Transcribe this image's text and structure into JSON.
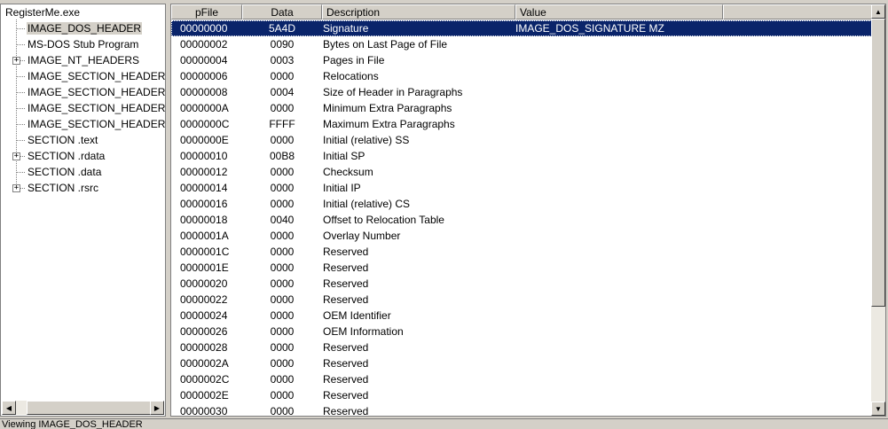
{
  "tree": {
    "root": "RegisterMe.exe",
    "items": [
      {
        "label": "IMAGE_DOS_HEADER",
        "expandable": false,
        "selected": true
      },
      {
        "label": "MS-DOS Stub Program",
        "expandable": false,
        "selected": false
      },
      {
        "label": "IMAGE_NT_HEADERS",
        "expandable": true,
        "selected": false
      },
      {
        "label": "IMAGE_SECTION_HEADER .text",
        "expandable": false,
        "selected": false
      },
      {
        "label": "IMAGE_SECTION_HEADER .rdata",
        "expandable": false,
        "selected": false
      },
      {
        "label": "IMAGE_SECTION_HEADER .data",
        "expandable": false,
        "selected": false
      },
      {
        "label": "IMAGE_SECTION_HEADER .rsrc",
        "expandable": false,
        "selected": false
      },
      {
        "label": "SECTION .text",
        "expandable": false,
        "selected": false
      },
      {
        "label": "SECTION .rdata",
        "expandable": true,
        "selected": false
      },
      {
        "label": "SECTION .data",
        "expandable": false,
        "selected": false
      },
      {
        "label": "SECTION .rsrc",
        "expandable": true,
        "selected": false
      }
    ],
    "expand_glyph": "+",
    "collapse_glyph": "-"
  },
  "scroll_arrows": {
    "left": "◀",
    "right": "▶",
    "up": "▲",
    "down": "▼"
  },
  "list": {
    "columns": [
      "pFile",
      "Data",
      "Description",
      "Value"
    ],
    "rows": [
      {
        "pfile": "00000000",
        "data": "5A4D",
        "desc": "Signature",
        "value": "IMAGE_DOS_SIGNATURE MZ",
        "selected": true
      },
      {
        "pfile": "00000002",
        "data": "0090",
        "desc": "Bytes on Last Page of File",
        "value": ""
      },
      {
        "pfile": "00000004",
        "data": "0003",
        "desc": "Pages in File",
        "value": ""
      },
      {
        "pfile": "00000006",
        "data": "0000",
        "desc": "Relocations",
        "value": ""
      },
      {
        "pfile": "00000008",
        "data": "0004",
        "desc": "Size of Header in Paragraphs",
        "value": ""
      },
      {
        "pfile": "0000000A",
        "data": "0000",
        "desc": "Minimum Extra Paragraphs",
        "value": ""
      },
      {
        "pfile": "0000000C",
        "data": "FFFF",
        "desc": "Maximum Extra Paragraphs",
        "value": ""
      },
      {
        "pfile": "0000000E",
        "data": "0000",
        "desc": "Initial (relative) SS",
        "value": ""
      },
      {
        "pfile": "00000010",
        "data": "00B8",
        "desc": "Initial SP",
        "value": ""
      },
      {
        "pfile": "00000012",
        "data": "0000",
        "desc": "Checksum",
        "value": ""
      },
      {
        "pfile": "00000014",
        "data": "0000",
        "desc": "Initial IP",
        "value": ""
      },
      {
        "pfile": "00000016",
        "data": "0000",
        "desc": "Initial (relative) CS",
        "value": ""
      },
      {
        "pfile": "00000018",
        "data": "0040",
        "desc": "Offset to Relocation Table",
        "value": ""
      },
      {
        "pfile": "0000001A",
        "data": "0000",
        "desc": "Overlay Number",
        "value": ""
      },
      {
        "pfile": "0000001C",
        "data": "0000",
        "desc": "Reserved",
        "value": ""
      },
      {
        "pfile": "0000001E",
        "data": "0000",
        "desc": "Reserved",
        "value": ""
      },
      {
        "pfile": "00000020",
        "data": "0000",
        "desc": "Reserved",
        "value": ""
      },
      {
        "pfile": "00000022",
        "data": "0000",
        "desc": "Reserved",
        "value": ""
      },
      {
        "pfile": "00000024",
        "data": "0000",
        "desc": "OEM Identifier",
        "value": ""
      },
      {
        "pfile": "00000026",
        "data": "0000",
        "desc": "OEM Information",
        "value": ""
      },
      {
        "pfile": "00000028",
        "data": "0000",
        "desc": "Reserved",
        "value": ""
      },
      {
        "pfile": "0000002A",
        "data": "0000",
        "desc": "Reserved",
        "value": ""
      },
      {
        "pfile": "0000002C",
        "data": "0000",
        "desc": "Reserved",
        "value": ""
      },
      {
        "pfile": "0000002E",
        "data": "0000",
        "desc": "Reserved",
        "value": ""
      },
      {
        "pfile": "00000030",
        "data": "0000",
        "desc": "Reserved",
        "value": ""
      }
    ]
  },
  "status": {
    "text": "Viewing IMAGE_DOS_HEADER"
  },
  "colors": {
    "selection": "#0a246a",
    "face": "#d4d0c8",
    "window": "#ffffff"
  }
}
